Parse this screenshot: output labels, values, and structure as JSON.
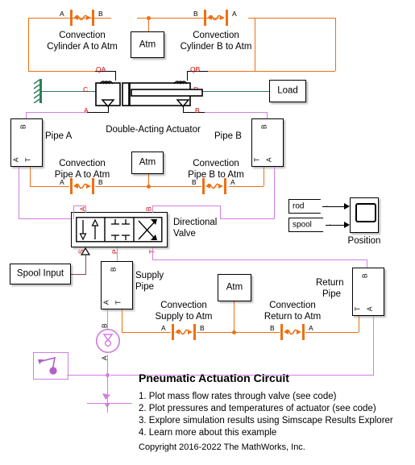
{
  "diagram": {
    "title": "Pneumatic Actuation Circuit",
    "copyright": "Copyright 2016-2022 The MathWorks, Inc.",
    "instructions": [
      "1. Plot mass flow rates through valve (see code)",
      "2. Plot pressures and temperatures of actuator (see code)",
      "3. Explore simulation results using Simscape Results Explorer",
      "4. Learn more about this example"
    ],
    "colors": {
      "thermal_orange": "#ed7014",
      "gas_magenta": "#d17fe0",
      "mechanical_green": "#2e7d5b",
      "port_label_red": "#d00000",
      "signal_black": "#000000",
      "physical_signal_maroon": "#8b4a52"
    }
  },
  "blocks": {
    "atm_top": {
      "label": "Atm"
    },
    "atm_mid": {
      "label": "Atm"
    },
    "atm_bottom": {
      "label": "Atm"
    },
    "load": {
      "label": "Load"
    },
    "spool_input": {
      "label": "Spool Input"
    },
    "pipe_a": {
      "label": "Pipe A",
      "ports": {
        "top": "B",
        "bottom_left": "A",
        "bottom_right": "T"
      }
    },
    "pipe_b": {
      "label": "Pipe B",
      "ports": {
        "top": "B",
        "bottom_left": "T",
        "bottom_right": "A"
      }
    },
    "supply_pipe": {
      "label_line1": "Supply",
      "label_line2": "Pipe",
      "ports": {
        "top": "B",
        "bottom_left": "A",
        "bottom_right": "T"
      }
    },
    "return_pipe": {
      "label_line1": "Return",
      "label_line2": "Pipe",
      "ports": {
        "top": "B",
        "bottom_left": "T",
        "bottom_right": "A"
      }
    },
    "directional_valve": {
      "label_line1": "Directional",
      "label_line2": "Valve",
      "ports": {
        "top_left": "A",
        "top_right": "B",
        "bottom_left": "S",
        "bottom_mid": "P",
        "bottom_right": "T"
      }
    },
    "actuator": {
      "label": "Double-Acting Actuator",
      "ports": {
        "qa": "QA",
        "qb": "QB",
        "c": "C",
        "r": "R",
        "a": "A",
        "b": "B"
      }
    },
    "compressor": {
      "ports": {
        "top": "B",
        "bottom": "A"
      }
    },
    "scope": {
      "label": "Position"
    },
    "tag_rod": {
      "label": "rod"
    },
    "tag_spool": {
      "label": "spool"
    }
  },
  "convection": {
    "cylinder_a": {
      "title_line1": "Convection",
      "title_line2": "Cylinder A to Atm",
      "port_left": "A",
      "port_right": "B"
    },
    "cylinder_b": {
      "title_line1": "Convection",
      "title_line2": "Cylinder B to Atm",
      "port_left": "B",
      "port_right": "A"
    },
    "pipe_a": {
      "title_line1": "Convection",
      "title_line2": "Pipe A to Atm",
      "port_left": "A",
      "port_right": "B"
    },
    "pipe_b": {
      "title_line1": "Convection",
      "title_line2": "Pipe B to Atm",
      "port_left": "B",
      "port_right": "A"
    },
    "supply": {
      "title_line1": "Convection",
      "title_line2": "Supply to Atm",
      "port_left": "A",
      "port_right": "B"
    },
    "return": {
      "title_line1": "Convection",
      "title_line2": "Return to Atm",
      "port_left": "B",
      "port_right": "A"
    }
  }
}
